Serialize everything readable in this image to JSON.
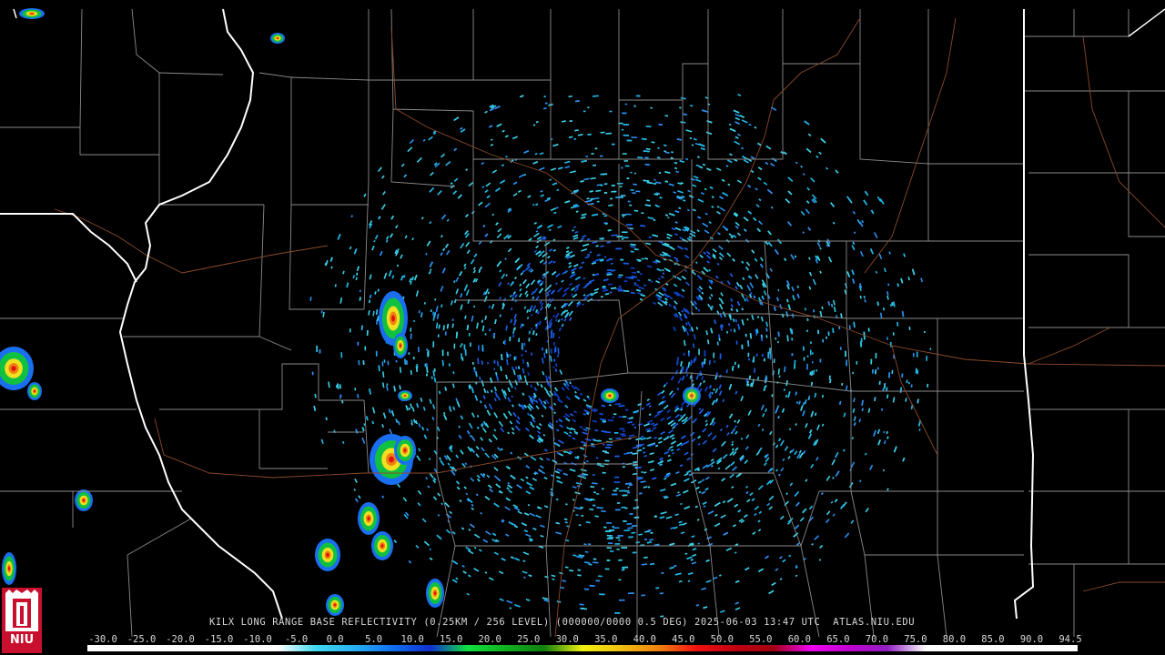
{
  "product": {
    "station": "KILX",
    "caption": "KILX LONG RANGE BASE REFLECTIVITY (0.25KM / 256 LEVEL) (000000/0000 0.5 DEG) 2025-06-03 13:47 UTC  ATLAS.NIU.EDU",
    "timestamp": "2025-06-03 13:47 UTC",
    "source": "ATLAS.NIU.EDU"
  },
  "logo": {
    "text": "NIU",
    "icon": "niu-tower-logo-icon"
  },
  "colorbar": {
    "labels": [
      "-30.0",
      "-25.0",
      "-20.0",
      "-15.0",
      "-10.0",
      "-5.0",
      "0.0",
      "5.0",
      "10.0",
      "15.0",
      "20.0",
      "25.0",
      "30.0",
      "35.0",
      "40.0",
      "45.0",
      "50.0",
      "55.0",
      "60.0",
      "65.0",
      "70.0",
      "75.0",
      "80.0",
      "85.0",
      "90.0",
      "94.5"
    ],
    "colors": [
      "#ffffff",
      "#f4f4f4",
      "#e8e8e8",
      "#dcdcdc",
      "#d0d0d0",
      "#c4c4c4",
      "#38d0e8",
      "#20b0f0",
      "#1060f0",
      "#1030d0",
      "#10e030",
      "#10b020",
      "#108010",
      "#f0f010",
      "#f0c010",
      "#f08010",
      "#f01010",
      "#c00010",
      "#a00010",
      "#f000f0",
      "#c000d0",
      "#9020c0",
      "#ffffff",
      "#ffffff",
      "#ffffff",
      "#ffffff"
    ]
  },
  "radar": {
    "center_lon": -89.34,
    "center_lat": 40.15,
    "inner_range_km": 40,
    "outer_range_km": 240
  },
  "colors": {
    "background": "#000000",
    "county_lines": "#8a8a8a",
    "state_lines": "#ffffff",
    "highways": "#8b4a2a"
  }
}
